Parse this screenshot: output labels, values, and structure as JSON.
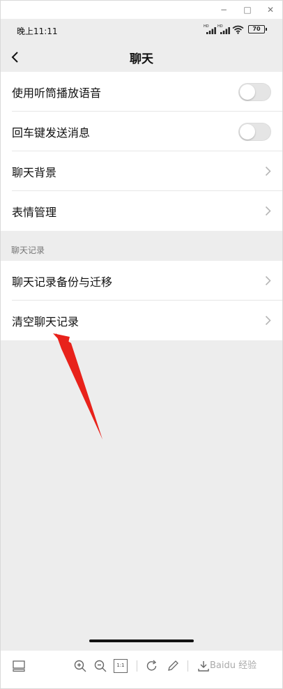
{
  "window": {
    "minimize_glyph": "−",
    "maximize_glyph": "□",
    "close_glyph": "✕"
  },
  "status_bar": {
    "time": "晚上11:11",
    "signal1_badge": "HD",
    "signal2_badge": "HD",
    "battery": "70"
  },
  "header": {
    "title": "聊天",
    "back_icon": "chevron-left-icon"
  },
  "settings": {
    "group1": [
      {
        "label": "使用听筒播放语音",
        "type": "toggle",
        "on": false
      },
      {
        "label": "回车键发送消息",
        "type": "toggle",
        "on": false
      },
      {
        "label": "聊天背景",
        "type": "link"
      },
      {
        "label": "表情管理",
        "type": "link"
      }
    ],
    "section2_header": "聊天记录",
    "group2": [
      {
        "label": "聊天记录备份与迁移",
        "type": "link"
      },
      {
        "label": "清空聊天记录",
        "type": "link"
      }
    ]
  },
  "toolbar": {
    "fit_label": "1:1",
    "watermark": "Baidu 经验",
    "icons": [
      "layout-icon",
      "zoom-in-icon",
      "zoom-out-icon",
      "actual-size-icon",
      "rotate-icon",
      "edit-icon",
      "download-icon"
    ]
  },
  "annotation": {
    "color": "#e8221b",
    "points_to": "清空聊天记录"
  },
  "colors": {
    "background": "#ededed",
    "surface": "#ffffff",
    "text": "#111111",
    "secondary_text": "#777777",
    "toggle_off": "#e5e5e5"
  }
}
